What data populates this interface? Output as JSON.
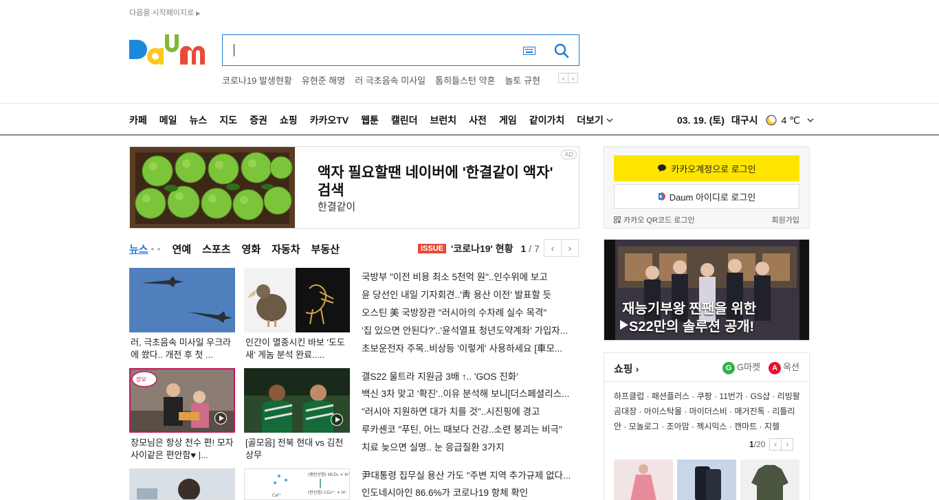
{
  "header": {
    "start_page_link": "다음을 시작페이지로",
    "logo_text": "Daum",
    "hot_keywords": [
      "코로나19 발생현황",
      "유현준 해명",
      "러 극초음속 미사일",
      "톰히들스턴 약혼",
      "놀토 규현"
    ]
  },
  "gnb": {
    "menu": [
      "카페",
      "메일",
      "뉴스",
      "지도",
      "증권",
      "쇼핑",
      "카카오TV",
      "웹툰",
      "캘린더",
      "브런치",
      "사전",
      "게임",
      "같이가치"
    ],
    "more_label": "더보기",
    "date": "03. 19. (토)",
    "city": "대구시",
    "temperature": "4 ℃"
  },
  "ad": {
    "title": "액자 필요할땐 네이버에 '한결같이 액자' 검색",
    "subtitle": "한결같이",
    "badge": "AD"
  },
  "news": {
    "tabs": [
      "뉴스",
      "연예",
      "스포츠",
      "영화",
      "자동차",
      "부동산"
    ],
    "issue_badge": "ISSUE",
    "issue_title": "'코로나19' 현황",
    "issue_page_current": "1",
    "issue_page_total": "/ 7",
    "thumbs": [
      {
        "caption": "러, 극초음속 미사일 우크라에 쐈다.. 개전 후 첫 ..."
      },
      {
        "caption": "인간이 멸종시킨 바보 '도도새' 게놈 분석 완료....."
      },
      {
        "caption": "장모님은 항상 천수 편! 모자사이같은 편안함♥ |..."
      },
      {
        "caption": "[골모음] 전북 현대 vs 김천 상무"
      }
    ],
    "headlines_group1": [
      "국방부 \"이전 비용 최소 5천억 원\"..인수위에 보고",
      "윤 당선인 내일 기자회견..'靑 용산 이전' 발표할 듯",
      "오스틴 美 국방장관 \"러시아의 수차례 실수 목격\"",
      "'집 있으면 안된다?'..'윤석열표 청년도약계좌' 가입자...",
      "초보운전자 주목..비상등 '이렇게' 사용하세요 [車모..."
    ],
    "headlines_group2": [
      "갤S22 울트라 지원금 3배 ↑.. 'GOS 진화'",
      "백신 3차 맞고 '확진'..이유 분석해 보니[더스페셜리스...",
      "\"러시아 지원하면 대가 치를 것\"..시진핑에 경고",
      "루카셴코 \"푸틴, 어느 때보다 건강..소련 붕괴는 비극\"",
      "치료 늦으면 실명.. 눈 응급질환 3가지"
    ],
    "headlines_group3": [
      "尹대통령 집무실 용산 가도 \"주변 지역 추가규제 없다...",
      "인도네시아인 86.6%가 코로나19 항체 확인"
    ]
  },
  "login": {
    "kakao_button": "카카오계정으로 로그인",
    "daum_button": "Daum 아이디로 로그인",
    "qr_login": "카카오 QR코드 로그인",
    "join": "회원가입"
  },
  "video_banner": {
    "line1": "재능기부왕 찐팬을 위한",
    "line2": "S22만의 솔루션 공개!"
  },
  "shopping": {
    "title": "쇼핑",
    "gmarket": "G마켓",
    "auction": "옥션",
    "partners": "하프클럽 · 패션플러스 · 쿠팡 · 11번가 · GS샵 · 리빙팔곰대장 · 아이스탁몰 · 마이더스비 · 매거진톡 · 리틀리안 · 모놀로그 · 조아맘 · 젝시믹스 · 캔마트 · 지젤",
    "page_current": "1",
    "page_total": "/20"
  },
  "colors": {
    "brand_blue": "#1e78d2",
    "kakao_yellow": "#fee500",
    "issue_red": "#e54b37"
  }
}
